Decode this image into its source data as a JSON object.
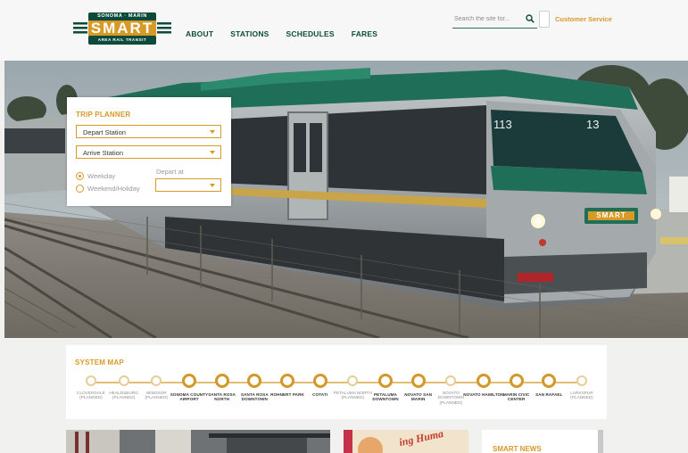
{
  "brand": {
    "top_text": "SONOMA · MARIN",
    "name": "SMART",
    "sub_text": "AREA RAIL TRANSIT",
    "primary_color": "#0e4a3c",
    "accent_color": "#d79a27"
  },
  "nav": [
    {
      "label": "ABOUT"
    },
    {
      "label": "STATIONS"
    },
    {
      "label": "SCHEDULES"
    },
    {
      "label": "FARES"
    }
  ],
  "search": {
    "placeholder": "Search the site for...",
    "icon": "search-icon"
  },
  "customer_service": "Customer Service",
  "hero": {
    "train_number_front": "113",
    "train_number_side": "13",
    "train_logo_text": "SMART"
  },
  "trip_planner": {
    "title": "TRIP PLANNER",
    "depart_station": "Depart Station",
    "arrive_station": "Arrive Station",
    "day_options": [
      {
        "label": "Weekday",
        "selected": true
      },
      {
        "label": "Weekend/Holiday",
        "selected": false
      }
    ],
    "depart_at_label": "Depart at",
    "depart_at_value": ""
  },
  "system_map": {
    "title": "SYSTEM MAP",
    "stations": [
      {
        "name": "CLOVERDALE (PLANNED)",
        "planned": true
      },
      {
        "name": "HEALDSBURG (PLANNED)",
        "planned": true
      },
      {
        "name": "WINDSOR (PLANNED)",
        "planned": true
      },
      {
        "name": "SONOMA COUNTY AIRPORT",
        "planned": false
      },
      {
        "name": "SANTA ROSA NORTH",
        "planned": false
      },
      {
        "name": "SANTA ROSA DOWNTOWN",
        "planned": false
      },
      {
        "name": "ROHNERT PARK",
        "planned": false
      },
      {
        "name": "COTATI",
        "planned": false
      },
      {
        "name": "PETALUMA NORTH (PLANNED)",
        "planned": true
      },
      {
        "name": "PETALUMA DOWNTOWN",
        "planned": false
      },
      {
        "name": "NOVATO SAN MARIN",
        "planned": false
      },
      {
        "name": "NOVATO DOWNTOWN (PLANNED)",
        "planned": true
      },
      {
        "name": "NOVATO HAMILTON",
        "planned": false
      },
      {
        "name": "MARIN CIVIC CENTER",
        "planned": false
      },
      {
        "name": "SAN RAFAEL",
        "planned": false
      },
      {
        "name": "LARKSPUR (PLANNED)",
        "planned": true
      }
    ]
  },
  "cards": {
    "card2_text": "ing Huma",
    "news_title": "SMART NEWS"
  }
}
